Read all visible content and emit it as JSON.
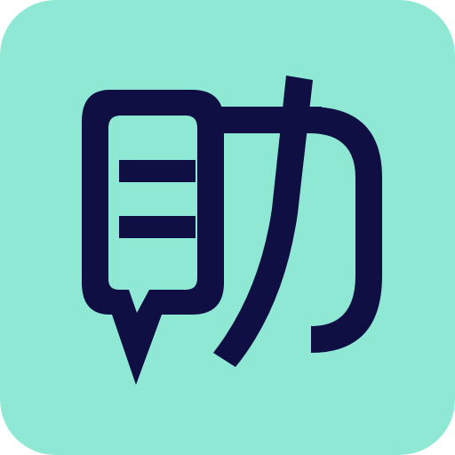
{
  "icon": {
    "name": "helper-app-icon",
    "glyph_name": "zhu-character-logo-icon",
    "colors": {
      "background": "#8FE8D4",
      "foreground": "#0F0F44"
    }
  }
}
